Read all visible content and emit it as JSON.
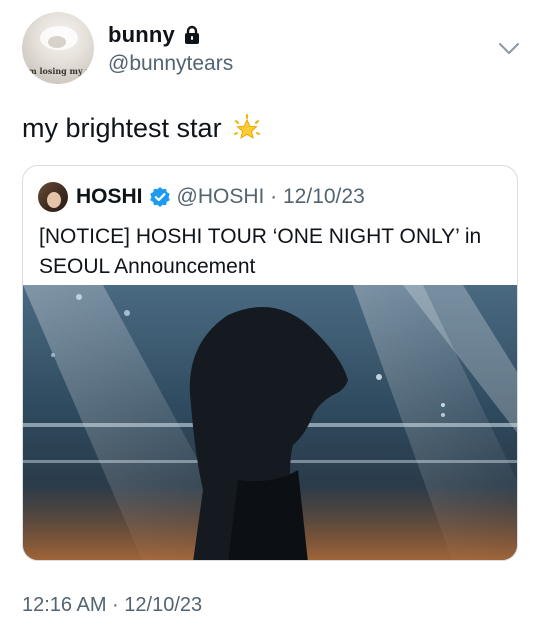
{
  "author": {
    "display_name": "bunny",
    "handle": "@bunnytears",
    "avatar_caption": "I'm losing my mind"
  },
  "tweet": {
    "text": "my brightest star",
    "timestamp": "12:16 AM · 12/10/23"
  },
  "quoted": {
    "name": "HOSHI",
    "handle_date": "@HOSHI · 12/10/23",
    "text": "[NOTICE] HOSHI TOUR ‘ONE NIGHT ONLY’ in SEOUL Announcement"
  },
  "colors": {
    "text": "#0f1419",
    "secondary": "#536471",
    "verified": "#1d9bf0",
    "border": "#d7dde1"
  },
  "icons": [
    "lock-icon",
    "chevron-down-icon",
    "glowing-star-icon",
    "verified-badge-icon"
  ]
}
